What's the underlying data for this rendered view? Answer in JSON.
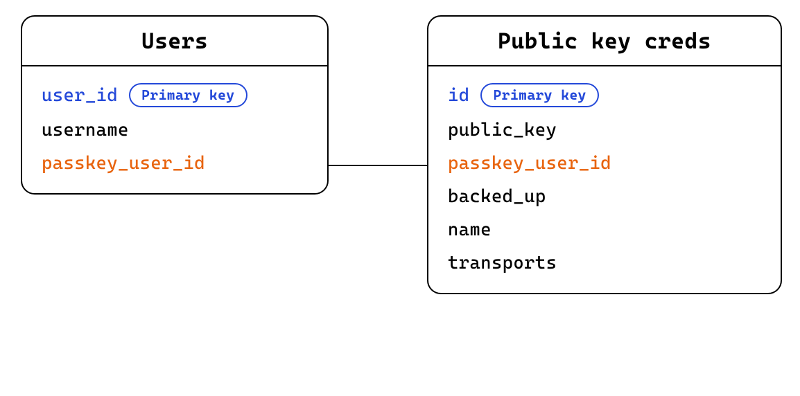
{
  "entities": {
    "users": {
      "title": "Users",
      "fields": [
        {
          "name": "user_id",
          "kind": "primary",
          "badge": "Primary key"
        },
        {
          "name": "username",
          "kind": "normal"
        },
        {
          "name": "passkey_user_id",
          "kind": "foreign"
        }
      ]
    },
    "creds": {
      "title": "Public key creds",
      "fields": [
        {
          "name": "id",
          "kind": "primary",
          "badge": "Primary key"
        },
        {
          "name": "public_key",
          "kind": "normal"
        },
        {
          "name": "passkey_user_id",
          "kind": "foreign"
        },
        {
          "name": "backed_up",
          "kind": "normal"
        },
        {
          "name": "name",
          "kind": "normal"
        },
        {
          "name": "transports",
          "kind": "normal"
        }
      ]
    }
  },
  "relation": {
    "from": "users.passkey_user_id",
    "to": "creds.passkey_user_id"
  },
  "colors": {
    "primary_key": "#2449d9",
    "foreign_key": "#e8640f",
    "border": "#000000",
    "background": "#ffffff"
  }
}
